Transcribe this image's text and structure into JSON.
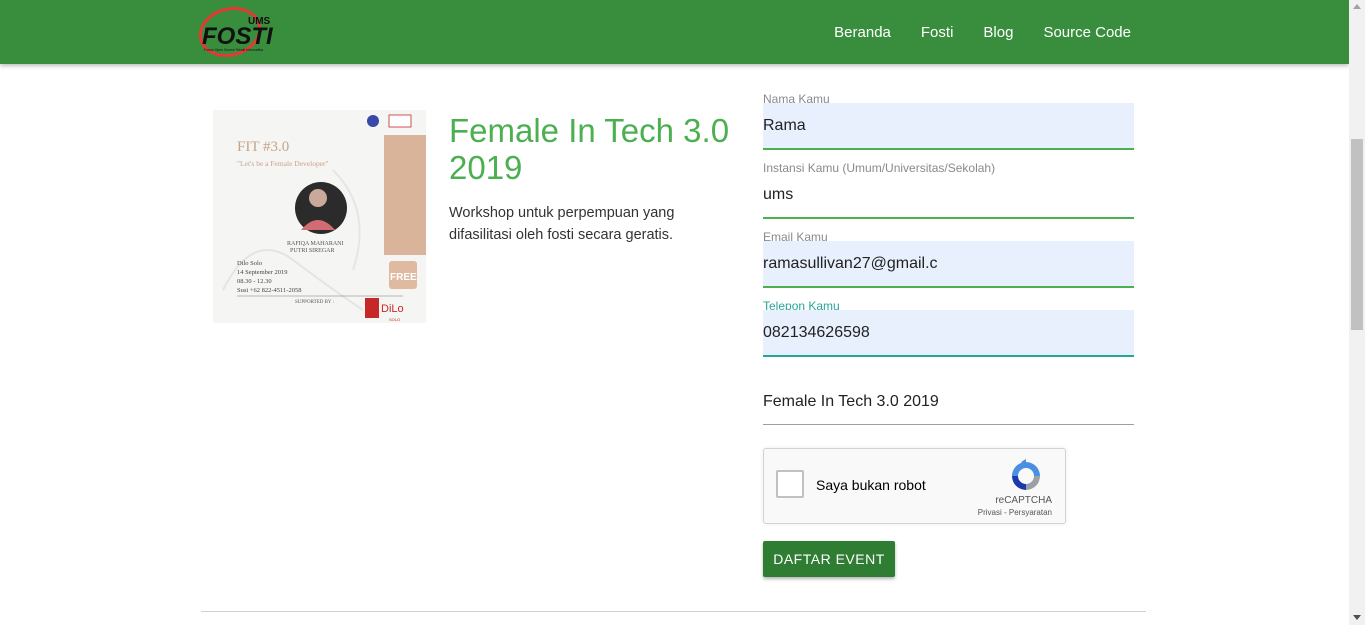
{
  "header": {
    "logo_small": "UMS",
    "logo_main": "FOSTI",
    "logo_tagline": "Forum Open Source Teknik Informatika",
    "nav": [
      {
        "label": "Beranda"
      },
      {
        "label": "Fosti"
      },
      {
        "label": "Blog"
      },
      {
        "label": "Source Code"
      }
    ],
    "color": "#388e3c"
  },
  "event": {
    "title": "Female In Tech 3.0 2019",
    "description": "Workshop untuk perpempuan yang difasilitasi oleh fosti secara geratis.",
    "poster": {
      "heading": "FIT #3.0",
      "tagline": "\"Let's be a Female Developer\"",
      "speaker_line1": "RAFIQA MAHARANI",
      "speaker_line2": "PUTRI SIREGAR",
      "venue": "Dilo Solo",
      "date": "14 September 2019",
      "time": "08.30 - 12.30",
      "contact": "Susi +62 822-4511-2058",
      "supported": "SUPPORTED BY :",
      "badge": "FREE",
      "sponsor": "DiLo",
      "sponsor_sub": "SOLO"
    }
  },
  "form": {
    "fields": [
      {
        "label": "Nama Kamu",
        "value": "Rama"
      },
      {
        "label": "Instansi Kamu (Umum/Universitas/Sekolah)",
        "value": "ums"
      },
      {
        "label": "Email Kamu",
        "value": "ramasullivan27@gmail.c"
      },
      {
        "label": "Telepon Kamu",
        "value": "082134626598"
      }
    ],
    "event_field": {
      "value": "Female In Tech 3.0 2019"
    },
    "recaptcha": {
      "label": "Saya bukan robot",
      "brand": "reCAPTCHA",
      "terms": "Privasi - Persyaratan"
    },
    "submit_label": "DAFTAR EVENT"
  },
  "colors": {
    "accent": "#4caf50",
    "active_field": "#26a69a",
    "button": "#2e7d32",
    "autofill": "#e8f0fe"
  }
}
